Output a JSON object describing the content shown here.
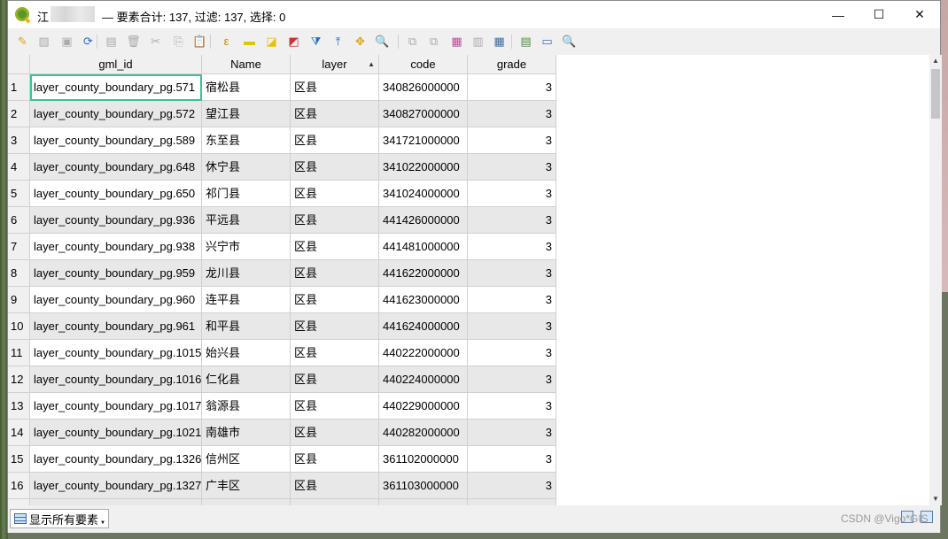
{
  "window": {
    "title_prefix": "江",
    "title_text": "— 要素合计: 137, 过滤: 137, 选择: 0",
    "min_glyph": "—",
    "max_glyph": "☐",
    "close_glyph": "✕"
  },
  "toolbar": {
    "items": [
      {
        "name": "toggle-editing-icon",
        "glyph": "✎",
        "color": "#d9a416",
        "enabled": true
      },
      {
        "name": "toggle-multi-edit-icon",
        "glyph": "▨",
        "color": "#aaaaaa",
        "enabled": false
      },
      {
        "name": "save-edits-icon",
        "glyph": "▣",
        "color": "#aaaaaa",
        "enabled": false
      },
      {
        "name": "reload-icon",
        "glyph": "⟳",
        "color": "#2b6cc4",
        "enabled": true
      },
      {
        "name": "add-feature-icon",
        "glyph": "▤",
        "color": "#aaaaaa",
        "enabled": false
      },
      {
        "name": "delete-feature-icon",
        "glyph": "🗑",
        "color": "#aaaaaa",
        "enabled": false
      },
      {
        "name": "cut-icon",
        "glyph": "✂",
        "color": "#aaaaaa",
        "enabled": false
      },
      {
        "name": "copy-icon",
        "glyph": "⎘",
        "color": "#aaaaaa",
        "enabled": false
      },
      {
        "name": "paste-icon",
        "glyph": "📋",
        "color": "#aaaaaa",
        "enabled": false
      },
      {
        "name": "select-by-expression-icon",
        "glyph": "ε",
        "color": "#c58b00",
        "enabled": true
      },
      {
        "name": "select-all-icon",
        "glyph": "▬",
        "color": "#e6c200",
        "enabled": true
      },
      {
        "name": "invert-selection-icon",
        "glyph": "◪",
        "color": "#e6c200",
        "enabled": true
      },
      {
        "name": "deselect-all-icon",
        "glyph": "◩",
        "color": "#d03030",
        "enabled": true
      },
      {
        "name": "filter-icon",
        "glyph": "⧩",
        "color": "#2b6cc4",
        "enabled": true
      },
      {
        "name": "move-selection-to-top-icon",
        "glyph": "⤒",
        "color": "#2b6cc4",
        "enabled": true
      },
      {
        "name": "pan-to-selection-icon",
        "glyph": "✥",
        "color": "#d9a416",
        "enabled": true
      },
      {
        "name": "zoom-to-selection-icon",
        "glyph": "🔍",
        "color": "#d9a416",
        "enabled": true
      },
      {
        "name": "copy-rows-icon",
        "glyph": "⧉",
        "color": "#aaaaaa",
        "enabled": false
      },
      {
        "name": "paste-rows-icon",
        "glyph": "⧉",
        "color": "#aaaaaa",
        "enabled": false
      },
      {
        "name": "new-field-icon",
        "glyph": "▦",
        "color": "#c04a9a",
        "enabled": true
      },
      {
        "name": "delete-field-icon",
        "glyph": "▥",
        "color": "#aaaaaa",
        "enabled": false
      },
      {
        "name": "open-field-calculator-icon",
        "glyph": "▦",
        "color": "#3a6ea5",
        "enabled": true
      },
      {
        "name": "conditional-formatting-icon",
        "glyph": "▤",
        "color": "#4a8f3a",
        "enabled": true
      },
      {
        "name": "actions-icon",
        "glyph": "▭",
        "color": "#3a6ea5",
        "enabled": true
      },
      {
        "name": "dock-icon",
        "glyph": "🔍",
        "color": "#3a6ea5",
        "enabled": true
      }
    ]
  },
  "table": {
    "columns": [
      "gml_id",
      "Name",
      "layer",
      "code",
      "grade"
    ],
    "rows": [
      {
        "n": "1",
        "gml_id": "layer_county_boundary_pg.571",
        "name": "宿松县",
        "layer": "区县",
        "code": "340826000000",
        "grade": "3"
      },
      {
        "n": "2",
        "gml_id": "layer_county_boundary_pg.572",
        "name": "望江县",
        "layer": "区县",
        "code": "340827000000",
        "grade": "3"
      },
      {
        "n": "3",
        "gml_id": "layer_county_boundary_pg.589",
        "name": "东至县",
        "layer": "区县",
        "code": "341721000000",
        "grade": "3"
      },
      {
        "n": "4",
        "gml_id": "layer_county_boundary_pg.648",
        "name": "休宁县",
        "layer": "区县",
        "code": "341022000000",
        "grade": "3"
      },
      {
        "n": "5",
        "gml_id": "layer_county_boundary_pg.650",
        "name": "祁门县",
        "layer": "区县",
        "code": "341024000000",
        "grade": "3"
      },
      {
        "n": "6",
        "gml_id": "layer_county_boundary_pg.936",
        "name": "平远县",
        "layer": "区县",
        "code": "441426000000",
        "grade": "3"
      },
      {
        "n": "7",
        "gml_id": "layer_county_boundary_pg.938",
        "name": "兴宁市",
        "layer": "区县",
        "code": "441481000000",
        "grade": "3"
      },
      {
        "n": "8",
        "gml_id": "layer_county_boundary_pg.959",
        "name": "龙川县",
        "layer": "区县",
        "code": "441622000000",
        "grade": "3"
      },
      {
        "n": "9",
        "gml_id": "layer_county_boundary_pg.960",
        "name": "连平县",
        "layer": "区县",
        "code": "441623000000",
        "grade": "3"
      },
      {
        "n": "10",
        "gml_id": "layer_county_boundary_pg.961",
        "name": "和平县",
        "layer": "区县",
        "code": "441624000000",
        "grade": "3"
      },
      {
        "n": "11",
        "gml_id": "layer_county_boundary_pg.1015",
        "name": "始兴县",
        "layer": "区县",
        "code": "440222000000",
        "grade": "3"
      },
      {
        "n": "12",
        "gml_id": "layer_county_boundary_pg.1016",
        "name": "仁化县",
        "layer": "区县",
        "code": "440224000000",
        "grade": "3"
      },
      {
        "n": "13",
        "gml_id": "layer_county_boundary_pg.1017",
        "name": "翁源县",
        "layer": "区县",
        "code": "440229000000",
        "grade": "3"
      },
      {
        "n": "14",
        "gml_id": "layer_county_boundary_pg.1021",
        "name": "南雄市",
        "layer": "区县",
        "code": "440282000000",
        "grade": "3"
      },
      {
        "n": "15",
        "gml_id": "layer_county_boundary_pg.1326",
        "name": "信州区",
        "layer": "区县",
        "code": "361102000000",
        "grade": "3"
      },
      {
        "n": "16",
        "gml_id": "layer_county_boundary_pg.1327",
        "name": "广丰区",
        "layer": "区县",
        "code": "361103000000",
        "grade": "3"
      }
    ]
  },
  "bottom": {
    "filter_label": "显示所有要素",
    "watermark": "CSDN @Vigo*GIS"
  },
  "colors": {
    "selection_outline": "#36c590",
    "alt_row": "#e8e8e8"
  }
}
